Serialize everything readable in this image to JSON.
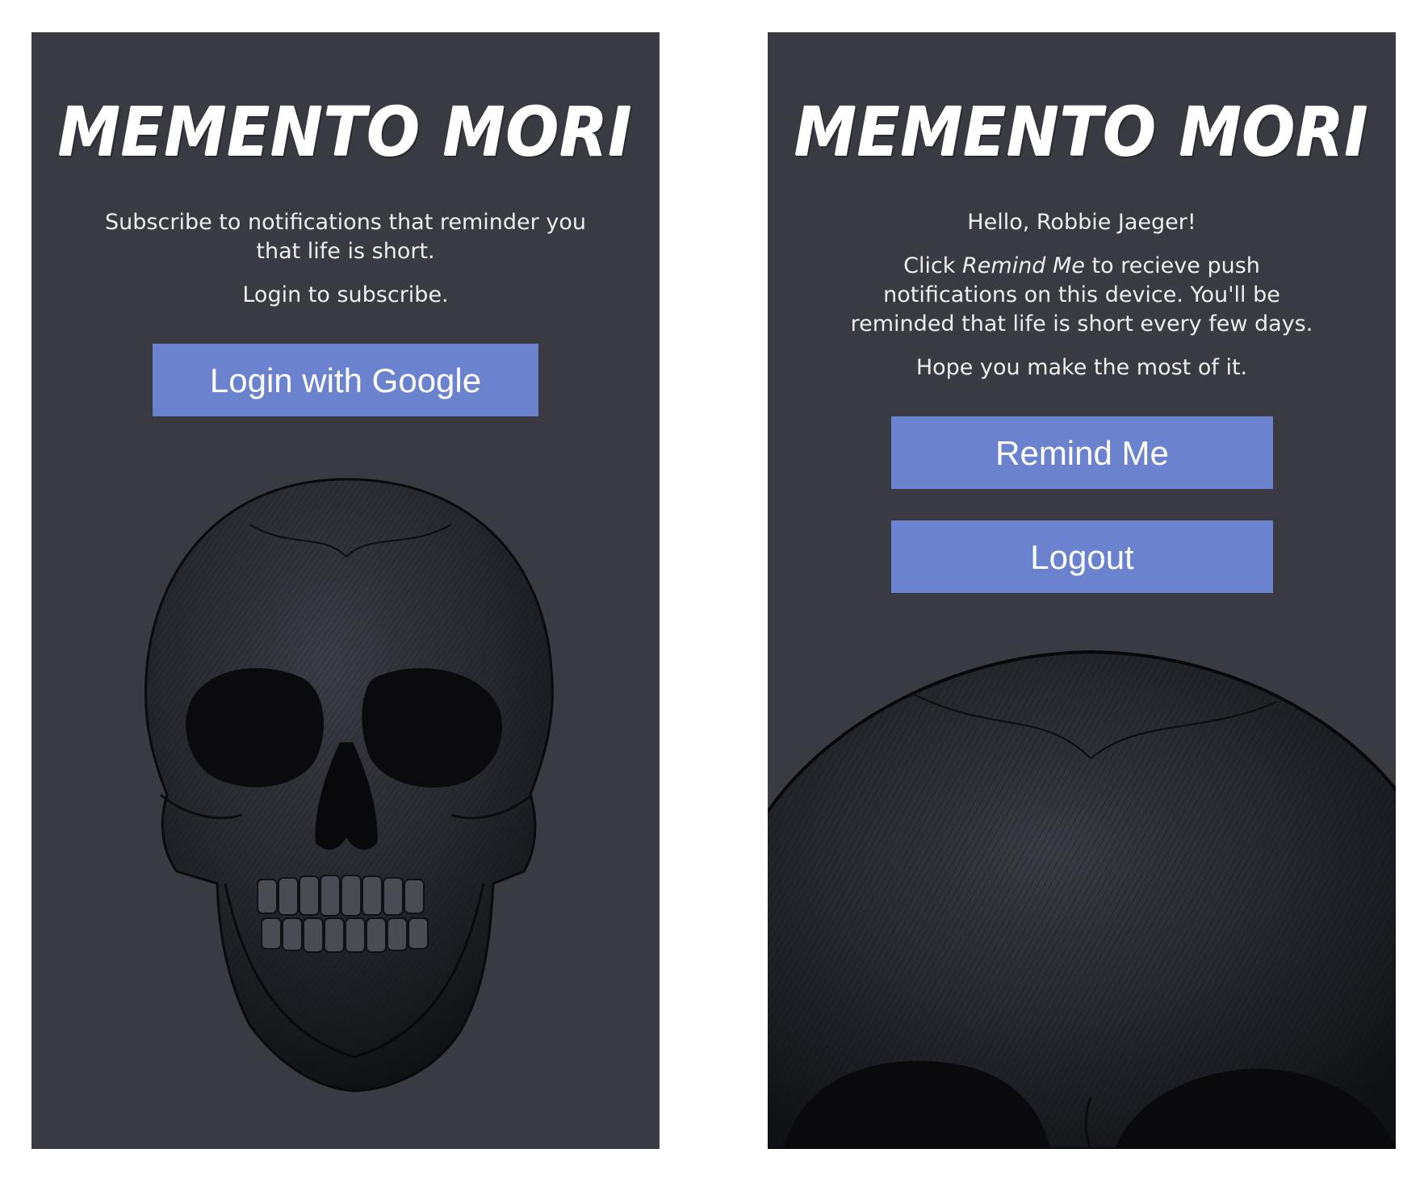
{
  "login_screen": {
    "logo": "MEMENTO MORI",
    "intro_line1": "Subscribe to notifications that reminder you",
    "intro_line2": "that life is short.",
    "login_prompt": "Login to subscribe.",
    "login_button": "Login with Google"
  },
  "home_screen": {
    "logo": "MEMENTO MORI",
    "greeting": "Hello, Robbie Jaeger!",
    "instructions_prefix": "Click ",
    "instructions_emphasis": "Remind Me",
    "instructions_line1_rest": " to recieve push",
    "instructions_line2": "notifications on this device. You'll be",
    "instructions_line3": "reminded that life is short every few days.",
    "closing": "Hope you make the most of it.",
    "remind_button": "Remind Me",
    "logout_button": "Logout"
  },
  "colors": {
    "screen_background": "#393a42",
    "button": "#6b83cf",
    "text": "#ffffff"
  },
  "icons": {
    "background_art": "skull-illustration"
  }
}
